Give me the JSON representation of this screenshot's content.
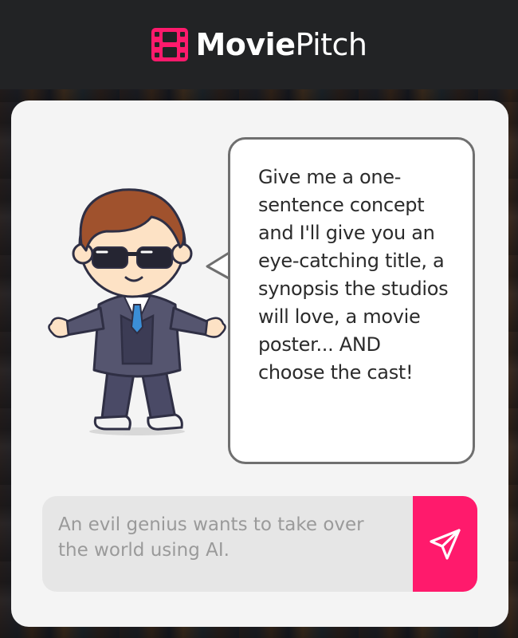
{
  "app": {
    "brand_bold": "Movie",
    "brand_light": "Pitch",
    "logo_icon": "film-reel-icon",
    "accent_color": "#ff1a6c"
  },
  "assistant": {
    "avatar_icon": "director-character-with-sunglasses",
    "message": "Give me a one-sentence concept and I'll give you an eye-catching title, a synopsis the studios will love, a movie poster... AND choose the cast!"
  },
  "composer": {
    "placeholder": "An evil genius wants to take over the world using AI.",
    "value": "",
    "send_icon": "send-paper-plane-icon"
  }
}
